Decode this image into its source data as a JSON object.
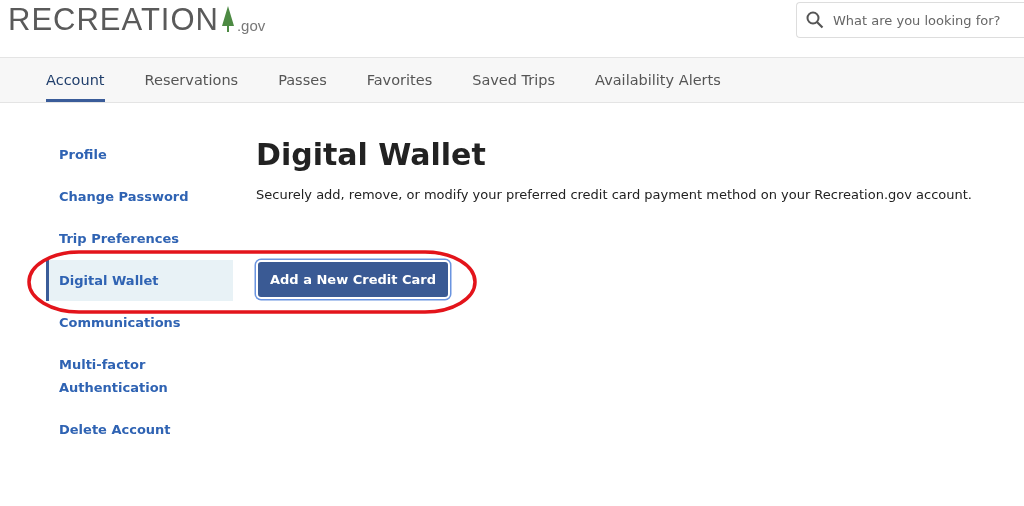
{
  "logo": {
    "name": "RECREATION",
    "suffix": ".gov"
  },
  "search": {
    "placeholder": "What are you looking for?"
  },
  "tabs": [
    {
      "label": "Account",
      "selected": true
    },
    {
      "label": "Reservations",
      "selected": false
    },
    {
      "label": "Passes",
      "selected": false
    },
    {
      "label": "Favorites",
      "selected": false
    },
    {
      "label": "Saved Trips",
      "selected": false
    },
    {
      "label": "Availability Alerts",
      "selected": false
    }
  ],
  "sidebar": {
    "items": [
      {
        "label": "Profile",
        "selected": false
      },
      {
        "label": "Change Password",
        "selected": false
      },
      {
        "label": "Trip Preferences",
        "selected": false
      },
      {
        "label": "Digital Wallet",
        "selected": true
      },
      {
        "label": "Communications",
        "selected": false
      },
      {
        "label": "Multi-factor Authentication",
        "selected": false
      },
      {
        "label": "Delete Account",
        "selected": false
      }
    ]
  },
  "main": {
    "title": "Digital Wallet",
    "description": "Securely add, remove, or modify your preferred credit card payment method on your Recreation.gov account.",
    "button": "Add a New Credit Card"
  }
}
